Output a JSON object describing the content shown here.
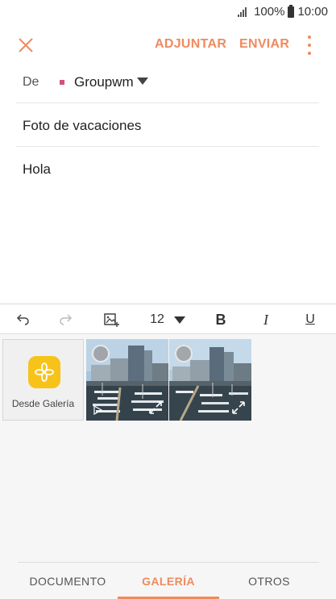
{
  "status": {
    "battery": "100%",
    "time": "10:00"
  },
  "header": {
    "attach_label": "ADJUNTAR",
    "send_label": "ENVIAR"
  },
  "compose": {
    "from_label": "De",
    "from_account": "Groupwm",
    "subject": "Foto de vacaciones",
    "body": "Hola"
  },
  "toolbar": {
    "font_size": "12",
    "bold": "B",
    "italic": "I",
    "underline": "U"
  },
  "attach_panel": {
    "gallery_label": "Desde Galería"
  },
  "tabs": [
    {
      "label": "DOCUMENTO",
      "active": false
    },
    {
      "label": "GALERÍA",
      "active": true
    },
    {
      "label": "OTROS",
      "active": false
    }
  ],
  "colors": {
    "accent": "#f08a5d",
    "account_dot": "#d3527a",
    "gallery_icon": "#f7c31a"
  }
}
